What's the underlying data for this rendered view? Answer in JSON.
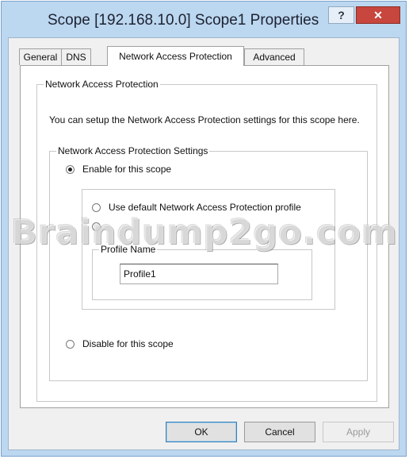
{
  "window": {
    "title": "Scope [192.168.10.0] Scope1 Properties",
    "help_label": "?",
    "close_label": "✕"
  },
  "tabs": [
    {
      "label": "General",
      "active": false
    },
    {
      "label": "DNS",
      "active": false
    },
    {
      "label": "Network Access Protection",
      "active": true
    },
    {
      "label": "Advanced",
      "active": false
    }
  ],
  "nap_group": {
    "legend": "Network Access Protection",
    "description": "You can setup the Network Access Protection settings for this scope here."
  },
  "settings_group": {
    "legend": "Network Access Protection Settings",
    "enable_label": "Enable for this scope",
    "enable_checked": true,
    "use_default_label": "Use default Network Access Protection profile",
    "use_default_checked": false,
    "use_custom_checked": false,
    "disable_label": "Disable for this scope",
    "disable_checked": false
  },
  "profile_group": {
    "legend": "Profile Name",
    "value": "Profile1"
  },
  "buttons": {
    "ok": "OK",
    "cancel": "Cancel",
    "apply": "Apply"
  },
  "watermark": "Braindump2go.com",
  "colors": {
    "frame": "#bcd7f0",
    "close_button": "#c7463d",
    "default_button_border": "#3c7fb1"
  }
}
